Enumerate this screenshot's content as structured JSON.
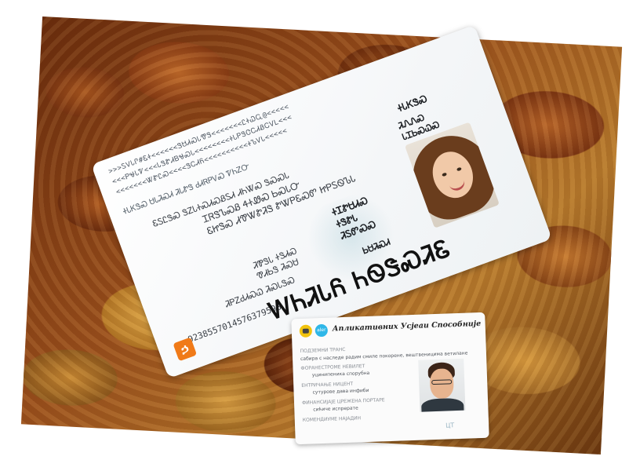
{
  "scene": {
    "background_photo": "golden raisins",
    "colors": {
      "raisin_dark": "#7a3512",
      "raisin_gold": "#d89a3e",
      "card_white": "#f4f6f8",
      "logo_orange": "#f07a18",
      "logo_yellow": "#f2c40f",
      "logo_blue": "#2fb7e8"
    }
  },
  "id_card": {
    "mrz": [
      ">>>ᏚᏙᏓᎵ#ᏋᏐ<<<<<<ᏕᏌᏗᏍᏓᏡᏕ<<<<<<<ᏝᏐᏇᏩ@<<<<<",
      "<<<ᏢᏠᏓᏤ<<<ᏓᏕᏑᏗᏴᏠᏍᏓ<<<<<<<<ᏐᏓᏢᏕᏣᏟᏗᏰᏟᏙᏞ<<<",
      "<<<<<<<ᏔᏑᏝᏍ<<<<ᏕᏟᏗᏲ<<<<<<<<<<ᏐᏖᏙᏓ<<<<<"
    ],
    "top_label": "ᏐᏓᏦᏕᏍ",
    "right_field_1": "ᏘᏁᏁᏍ",
    "right_field_2": "ᏓᏆᏏᏍᏇᏍ",
    "sig_line": "ᏐᏓᏦᏕᏍ ᏌᏓᏘᏍᏗ ᏘᏓᏑᏕ ᏧᏗᏒᏢᏙᏍ ᏤᏂᏃᏅ",
    "left_line_1": "ᏆᏒᏕᏖᏍᏰ ᏎᏐᏪᏍ ᏏᏍᏓᏅ",
    "left_line_2": "ᏋᏥᏕᏍ ᏗᏡᏔᏑᏘᏕ ᏑᏔᏢᏋᏍᏛ ᏥᏢᏚᏫᏖᏓ",
    "left_line_3": "ᏋᏚᏝᏕᏍ ᏕᏃᏓᏐᏍᏗᏍᏰᏚᏗ ᏗᏂᏔᏍ ᏕᏍᏍᏓ",
    "mid_1": "ᏐᏆᏑᏌᏗᏍ",
    "mid_2": "ᏐᏕᏑᏓ",
    "mid_3": "ᏘᏚᏛᏍᏍ",
    "low_1": "ᏘᏈᏕᏓ ᏐᏕᏗᏍ",
    "low_2": "ᏡᏗᏏᏕ ᏘᏍᏌ",
    "low_3": "ᏘᏢᏃᏧᏗᏍᏇ ᏘᏍᏓᏕᏍ",
    "low_4": "ᏏᏌᏘᏍᏗ",
    "number": "9238557014576379598",
    "holder_name": "ᎳᏂᏘᏓᏲ ᏂᏫᏕᏍᏘᏋ"
  },
  "app_card": {
    "title": "Апликативних Усјеаи Способније",
    "logo_badge": "aler",
    "fields": [
      {
        "label": "ПОДЗЕМНИ ТРАНС",
        "value": ""
      },
      {
        "label": "",
        "value": "сабира с наследе радим смиле покорене, вештвеницима ветилане"
      },
      {
        "label": "ФОРАНЕСТРОМЕ НЕВИЛЕТ",
        "value": "уцинипеника спорубна"
      },
      {
        "label": "ЕНТРИЧАЊЕ НИЦЕНТ",
        "value": "сутурове дава инфиби"
      },
      {
        "label": "ФИНАНСИЈАЈЕ ЦРЕЖЕНА ПОРТАРЕ",
        "value": "сићиче испрерате"
      },
      {
        "label": "КОМЕНДИУМЕ НАЈАДИН",
        "value": ""
      }
    ],
    "stamp": "ЦТ"
  }
}
